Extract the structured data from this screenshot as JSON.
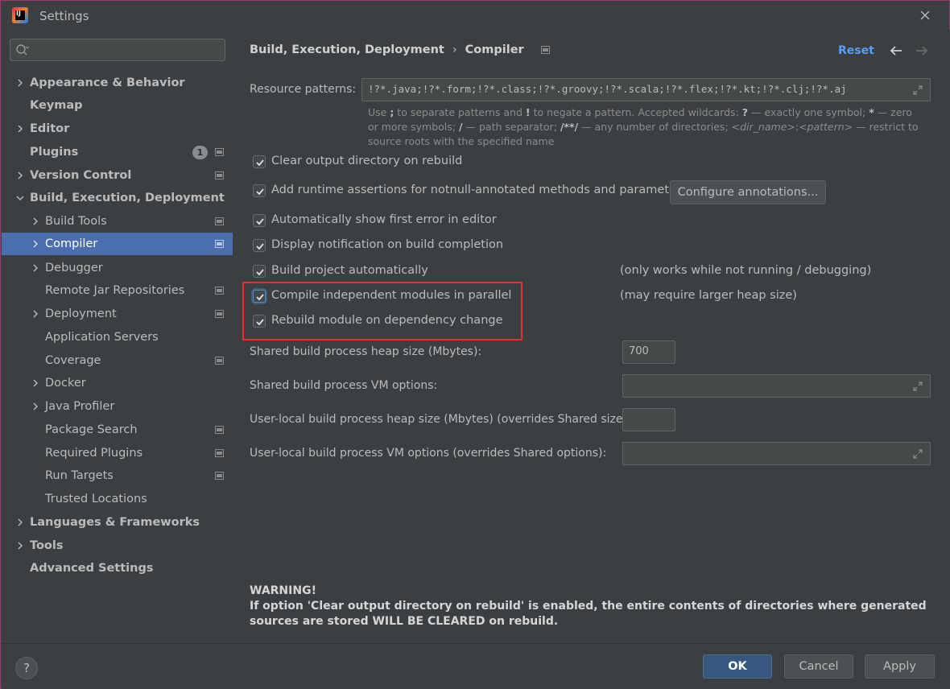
{
  "window": {
    "title": "Settings"
  },
  "sidebar": {
    "search": {
      "value": "",
      "placeholder": ""
    },
    "items": [
      {
        "label": "Appearance & Behavior",
        "bold": true,
        "chevron": true
      },
      {
        "label": "Keymap",
        "bold": true,
        "chevron": false
      },
      {
        "label": "Editor",
        "bold": true,
        "chevron": true
      },
      {
        "label": "Plugins",
        "bold": true,
        "chevron": false,
        "badge": "1"
      },
      {
        "label": "Version Control",
        "bold": true,
        "chevron": true
      },
      {
        "label": "Build, Execution, Deployment",
        "bold": true,
        "chevron": true,
        "expanded": true
      },
      {
        "label": "Build Tools",
        "chevron": true
      },
      {
        "label": "Compiler",
        "chevron": true,
        "selected": true
      },
      {
        "label": "Debugger",
        "chevron": true
      },
      {
        "label": "Remote Jar Repositories",
        "chevron": false
      },
      {
        "label": "Deployment",
        "chevron": true
      },
      {
        "label": "Application Servers",
        "chevron": false
      },
      {
        "label": "Coverage",
        "chevron": false
      },
      {
        "label": "Docker",
        "chevron": true
      },
      {
        "label": "Java Profiler",
        "chevron": true
      },
      {
        "label": "Package Search",
        "chevron": false
      },
      {
        "label": "Required Plugins",
        "chevron": false
      },
      {
        "label": "Run Targets",
        "chevron": false
      },
      {
        "label": "Trusted Locations",
        "chevron": false
      },
      {
        "label": "Languages & Frameworks",
        "bold": true,
        "chevron": true
      },
      {
        "label": "Tools",
        "bold": true,
        "chevron": true
      },
      {
        "label": "Advanced Settings",
        "bold": true,
        "chevron": false
      }
    ]
  },
  "header": {
    "breadcrumb_parent": "Build, Execution, Deployment",
    "breadcrumb_separator": "›",
    "breadcrumb_current": "Compiler",
    "reset_label": "Reset"
  },
  "compiler": {
    "resource_patterns_label": "Resource patterns:",
    "resource_patterns_value": "!?*.java;!?*.form;!?*.class;!?*.groovy;!?*.scala;!?*.flex;!?*.kt;!?*.clj;!?*.aj",
    "hint": {
      "p1": "Use ",
      "semicolon": ";",
      "p2": " to separate patterns and ",
      "bang": "!",
      "p3": " to negate a pattern. Accepted wildcards: ",
      "q": "?",
      "p4": " — exactly one symbol; ",
      "star": "*",
      "p5": " — zero or more symbols; ",
      "slash": "/",
      "p6": " — path separator; ",
      "dstar": "/**/",
      "p7": " — any number of directories; ",
      "dir_name": "<dir_name>",
      "colon": ":",
      "pattern": "<pattern>",
      "p8": " — restrict to source roots with the specified name"
    },
    "options": {
      "clear_output": "Clear output directory on rebuild",
      "runtime_assertions": "Add runtime assertions for notnull-annotated methods and parameters",
      "configure_annotations": "Configure annotations...",
      "show_first_error": "Automatically show first error in editor",
      "display_notification": "Display notification on build completion",
      "build_automatically": "Build project automatically",
      "build_automatically_note": "(only works while not running / debugging)",
      "compile_parallel": "Compile independent modules in parallel",
      "compile_parallel_note": "(may require larger heap size)",
      "rebuild_on_change": "Rebuild module on dependency change"
    },
    "shared_heap_label": "Shared build process heap size (Mbytes):",
    "shared_heap_value": "700",
    "shared_vm_label": "Shared build process VM options:",
    "shared_vm_value": "",
    "user_heap_label": "User-local build process heap size (Mbytes) (overrides Shared size):",
    "user_heap_value": "",
    "user_vm_label": "User-local build process VM options (overrides Shared options):",
    "user_vm_value": "",
    "warning_title": "WARNING!",
    "warning_text": "If option 'Clear output directory on rebuild' is enabled, the entire contents of directories where generated sources are stored WILL BE CLEARED on rebuild."
  },
  "footer": {
    "help_label": "?",
    "ok_label": "OK",
    "cancel_label": "Cancel",
    "apply_label": "Apply"
  },
  "colors": {
    "background": "#3c3f41",
    "selection": "#4b6eaf",
    "accent_link": "#589df6",
    "primary_button": "#365880",
    "highlight_annotation": "#e03131"
  }
}
